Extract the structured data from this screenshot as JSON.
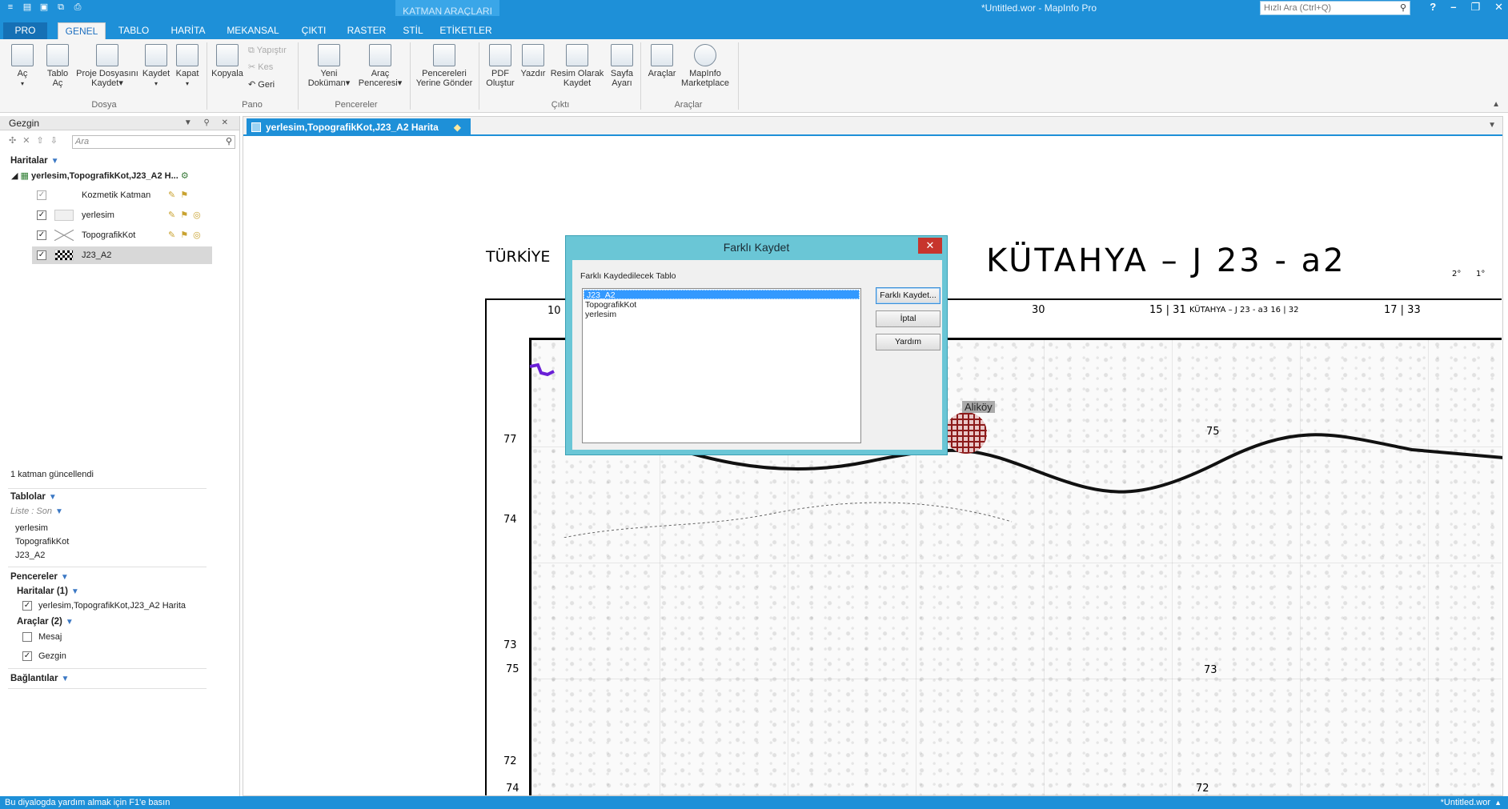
{
  "window": {
    "title": "*Untitled.wor - MapInfo Pro",
    "context_group": "KATMAN ARAÇLARI",
    "quick_search_placeholder": "Hızlı Ara (Ctrl+Q)",
    "help": "?",
    "minimize": "–",
    "restore": "❐",
    "close": "✕"
  },
  "tabs": [
    "PRO",
    "GENEL",
    "TABLO",
    "HARİTA",
    "MEKANSAL",
    "ÇIKTI",
    "RASTER",
    "STİL",
    "ETİKETLER"
  ],
  "ribbon": {
    "ac": "Aç",
    "tablo_ac_1": "Tablo",
    "tablo_ac_2": "Aç",
    "proje_1": "Proje Dosyasını",
    "proje_2": "Kaydet",
    "kaydet": "Kaydet",
    "kapat": "Kapat",
    "group_dosya": "Dosya",
    "kopyala": "Kopyala",
    "yapistir": "Yapıştır",
    "kes": "Kes",
    "geri": "Geri",
    "group_pano": "Pano",
    "yeni_1": "Yeni",
    "yeni_2": "Doküman",
    "arac_1": "Araç",
    "arac_2": "Penceresi",
    "pencereleri_1": "Pencereleri",
    "pencereleri_2": "Yerine Gönder",
    "group_pencereler": "Pencereler",
    "pdf_1": "PDF",
    "pdf_2": "Oluştur",
    "yazdir": "Yazdır",
    "resim_1": "Resim Olarak",
    "resim_2": "Kaydet",
    "sayfa_1": "Sayfa",
    "sayfa_2": "Ayarı",
    "group_cikti": "Çıktı",
    "araclar": "Araçlar",
    "mp_1": "MapInfo",
    "mp_2": "Marketplace",
    "group_araclar": "Araçlar"
  },
  "navigator": {
    "title": "Gezgin",
    "search_placeholder": "Ara",
    "haritalar": "Haritalar",
    "map_node": "yerlesim,TopografikKot,J23_A2 H...",
    "layers": [
      {
        "name": "Kozmetik Katman",
        "checked": true
      },
      {
        "name": "yerlesim",
        "checked": true
      },
      {
        "name": "TopografikKot",
        "checked": true
      },
      {
        "name": "J23_A2",
        "checked": true
      }
    ],
    "update_msg": "1 katman güncellendi",
    "tablolar": "Tablolar",
    "liste_son": "Liste : Son",
    "tables": [
      "yerlesim",
      "TopografikKot",
      "J23_A2"
    ],
    "pencereler": "Pencereler",
    "haritalar_count": "Haritalar  (1)",
    "map_window": "yerlesim,TopografikKot,J23_A2 Harita",
    "araclar_count": "Araçlar  (2)",
    "mesaj": "Mesaj",
    "gezgin": "Gezgin",
    "baglantilar": "Bağlantılar"
  },
  "document": {
    "tab_title": "yerlesim,TopografikKot,J23_A2 Harita"
  },
  "map": {
    "title_big": "KÜTAHYA – J 23 - a2",
    "title_left": "TÜRKİYE",
    "settlement_label": "Aliköy",
    "coord_top_30": "30",
    "coord_top_31": "15 | 31",
    "coord_top_mid": "KÜTAHYA – J 23 - a3 16 | 32",
    "coord_top_33": "17 | 33",
    "coord_top_10": "10",
    "left_77": "77",
    "left_74": "74",
    "left_73": "73",
    "left_75": "75",
    "left_72": "72",
    "left_74b": "74",
    "val_75": "75",
    "val_73": "73",
    "val_72": "72",
    "deg_a": "2°",
    "deg_b": "1°"
  },
  "dialog": {
    "title": "Farklı Kaydet",
    "label": "Farklı Kaydedilecek Tablo",
    "items": [
      "J23_A2",
      "TopografikKot",
      "yerlesim"
    ],
    "save_as": "Farklı Kaydet...",
    "cancel": "İptal",
    "help": "Yardım"
  },
  "status": {
    "left": "Bu diyalogda yardım almak için F1'e basın",
    "right": "*Untitled.wor"
  },
  "colors": {
    "accent": "#1e90d8",
    "dialog_frame": "#6ac6d6",
    "close_red": "#c7352d",
    "settlement": "#8c1a1a"
  }
}
